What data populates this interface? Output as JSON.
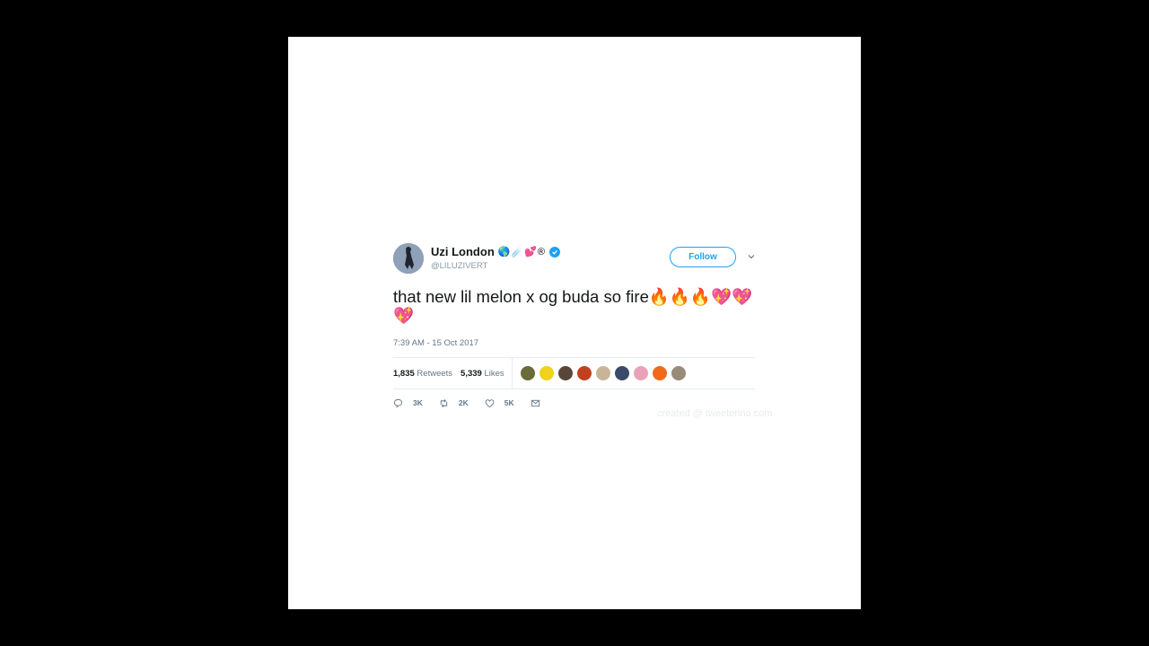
{
  "tweet": {
    "display_name": "Uzi London",
    "name_emojis": "🌎☄️💕®",
    "handle": "@LILUZIVERT",
    "follow_label": "Follow",
    "text": "that new lil melon x og buda so fire🔥🔥🔥💖💖💖",
    "timestamp": "7:39 AM - 15 Oct 2017",
    "retweets_count": "1,835",
    "retweets_label": "Retweets",
    "likes_count": "5,339",
    "likes_label": "Likes",
    "actions": {
      "reply_count": "3K",
      "retweet_count": "2K",
      "like_count": "5K"
    }
  },
  "watermark": "created @ tweeterino.com",
  "colors": {
    "accent": "#1da1f2",
    "text": "#14171a",
    "muted": "#657786",
    "background": "#000000",
    "card": "#ffffff"
  },
  "liker_avatars": [
    "#6b6b3a",
    "#f1d21a",
    "#5a4638",
    "#c2411d",
    "#c9b49a",
    "#3a4a6b",
    "#e9a3b8",
    "#f06a1c",
    "#9a8a7a"
  ]
}
